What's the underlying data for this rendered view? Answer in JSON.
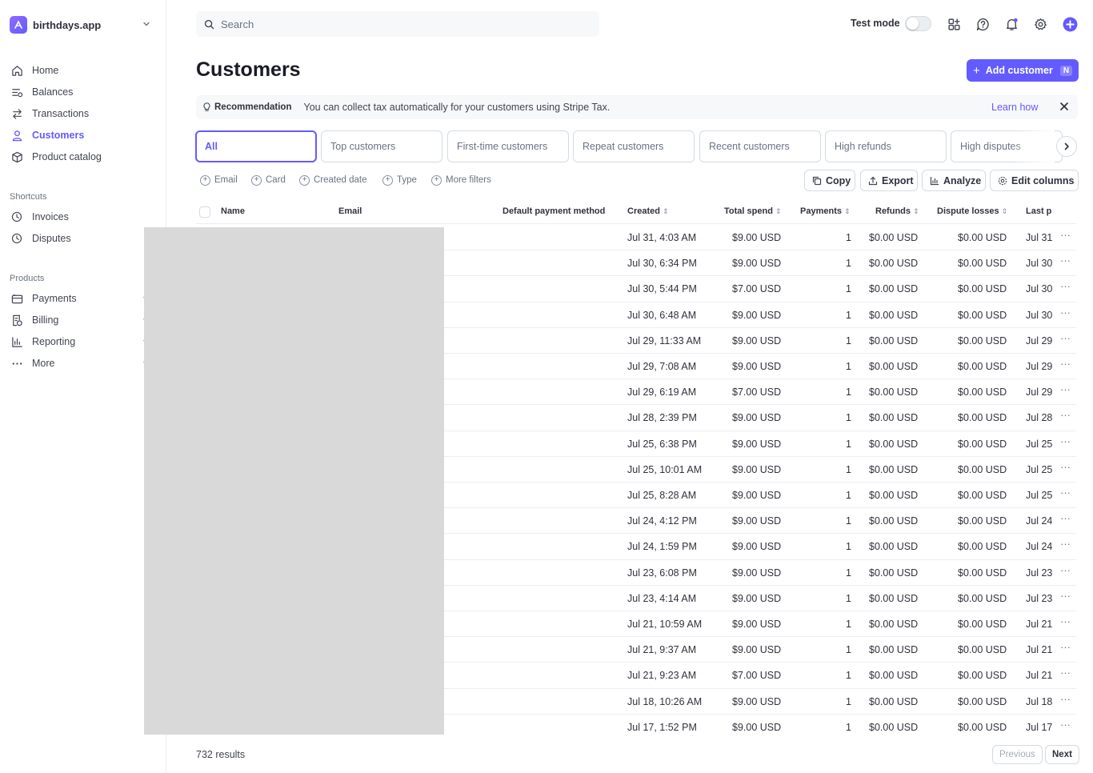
{
  "brand": {
    "name": "birthdays.app"
  },
  "sidebar": {
    "items": [
      {
        "label": "Home",
        "icon": "home-icon"
      },
      {
        "label": "Balances",
        "icon": "balances-icon"
      },
      {
        "label": "Transactions",
        "icon": "transactions-icon"
      },
      {
        "label": "Customers",
        "icon": "customers-icon",
        "active": true
      },
      {
        "label": "Product catalog",
        "icon": "product-catalog-icon"
      }
    ],
    "shortcuts_label": "Shortcuts",
    "shortcuts": [
      {
        "label": "Invoices",
        "icon": "clock-icon"
      },
      {
        "label": "Disputes",
        "icon": "clock-icon"
      }
    ],
    "products_label": "Products",
    "products": [
      {
        "label": "Payments",
        "icon": "payments-icon"
      },
      {
        "label": "Billing",
        "icon": "billing-icon"
      },
      {
        "label": "Reporting",
        "icon": "reporting-icon"
      },
      {
        "label": "More",
        "icon": "more-icon"
      }
    ]
  },
  "topbar": {
    "search_placeholder": "Search",
    "test_mode_label": "Test mode",
    "test_mode_on": false
  },
  "header": {
    "title": "Customers",
    "add_button_label": "Add customer",
    "add_button_shortcut": "N"
  },
  "banner": {
    "label": "Recommendation",
    "text": "You can collect tax automatically for your customers using Stripe Tax.",
    "link": "Learn how"
  },
  "tabs": [
    {
      "label": "All",
      "active": true
    },
    {
      "label": "Top customers"
    },
    {
      "label": "First-time customers"
    },
    {
      "label": "Repeat customers"
    },
    {
      "label": "Recent customers"
    },
    {
      "label": "High refunds"
    },
    {
      "label": "High disputes"
    }
  ],
  "filters": [
    "Email",
    "Card",
    "Created date",
    "Type",
    "More filters"
  ],
  "actions": [
    "Copy",
    "Export",
    "Analyze",
    "Edit columns"
  ],
  "table": {
    "columns": [
      "Name",
      "Email",
      "Default payment method",
      "Created",
      "Total spend",
      "Payments",
      "Refunds",
      "Dispute losses",
      "Last p"
    ],
    "rows": [
      {
        "created": "Jul 31, 4:03 AM",
        "total": "$9.00 USD",
        "payments": "1",
        "refunds": "$0.00 USD",
        "disputes": "$0.00 USD",
        "last": "Jul 31"
      },
      {
        "created": "Jul 30, 6:34 PM",
        "total": "$9.00 USD",
        "payments": "1",
        "refunds": "$0.00 USD",
        "disputes": "$0.00 USD",
        "last": "Jul 30"
      },
      {
        "created": "Jul 30, 5:44 PM",
        "total": "$7.00 USD",
        "payments": "1",
        "refunds": "$0.00 USD",
        "disputes": "$0.00 USD",
        "last": "Jul 30"
      },
      {
        "created": "Jul 30, 6:48 AM",
        "total": "$9.00 USD",
        "payments": "1",
        "refunds": "$0.00 USD",
        "disputes": "$0.00 USD",
        "last": "Jul 30"
      },
      {
        "created": "Jul 29, 11:33 AM",
        "total": "$9.00 USD",
        "payments": "1",
        "refunds": "$0.00 USD",
        "disputes": "$0.00 USD",
        "last": "Jul 29"
      },
      {
        "created": "Jul 29, 7:08 AM",
        "total": "$9.00 USD",
        "payments": "1",
        "refunds": "$0.00 USD",
        "disputes": "$0.00 USD",
        "last": "Jul 29"
      },
      {
        "created": "Jul 29, 6:19 AM",
        "total": "$7.00 USD",
        "payments": "1",
        "refunds": "$0.00 USD",
        "disputes": "$0.00 USD",
        "last": "Jul 29"
      },
      {
        "created": "Jul 28, 2:39 PM",
        "total": "$9.00 USD",
        "payments": "1",
        "refunds": "$0.00 USD",
        "disputes": "$0.00 USD",
        "last": "Jul 28"
      },
      {
        "created": "Jul 25, 6:38 PM",
        "total": "$9.00 USD",
        "payments": "1",
        "refunds": "$0.00 USD",
        "disputes": "$0.00 USD",
        "last": "Jul 25"
      },
      {
        "created": "Jul 25, 10:01 AM",
        "total": "$9.00 USD",
        "payments": "1",
        "refunds": "$0.00 USD",
        "disputes": "$0.00 USD",
        "last": "Jul 25"
      },
      {
        "created": "Jul 25, 8:28 AM",
        "total": "$9.00 USD",
        "payments": "1",
        "refunds": "$0.00 USD",
        "disputes": "$0.00 USD",
        "last": "Jul 25"
      },
      {
        "created": "Jul 24, 4:12 PM",
        "total": "$9.00 USD",
        "payments": "1",
        "refunds": "$0.00 USD",
        "disputes": "$0.00 USD",
        "last": "Jul 24"
      },
      {
        "created": "Jul 24, 1:59 PM",
        "total": "$9.00 USD",
        "payments": "1",
        "refunds": "$0.00 USD",
        "disputes": "$0.00 USD",
        "last": "Jul 24"
      },
      {
        "created": "Jul 23, 6:08 PM",
        "total": "$9.00 USD",
        "payments": "1",
        "refunds": "$0.00 USD",
        "disputes": "$0.00 USD",
        "last": "Jul 23"
      },
      {
        "created": "Jul 23, 4:14 AM",
        "total": "$9.00 USD",
        "payments": "1",
        "refunds": "$0.00 USD",
        "disputes": "$0.00 USD",
        "last": "Jul 23"
      },
      {
        "created": "Jul 21, 10:59 AM",
        "total": "$9.00 USD",
        "payments": "1",
        "refunds": "$0.00 USD",
        "disputes": "$0.00 USD",
        "last": "Jul 21"
      },
      {
        "created": "Jul 21, 9:37 AM",
        "total": "$9.00 USD",
        "payments": "1",
        "refunds": "$0.00 USD",
        "disputes": "$0.00 USD",
        "last": "Jul 21"
      },
      {
        "created": "Jul 21, 9:23 AM",
        "total": "$7.00 USD",
        "payments": "1",
        "refunds": "$0.00 USD",
        "disputes": "$0.00 USD",
        "last": "Jul 21"
      },
      {
        "created": "Jul 18, 10:26 AM",
        "total": "$9.00 USD",
        "payments": "1",
        "refunds": "$0.00 USD",
        "disputes": "$0.00 USD",
        "last": "Jul 18"
      },
      {
        "created": "Jul 17, 1:52 PM",
        "total": "$9.00 USD",
        "payments": "1",
        "refunds": "$0.00 USD",
        "disputes": "$0.00 USD",
        "last": "Jul 17"
      }
    ]
  },
  "footer": {
    "results": "732 results",
    "previous": "Previous",
    "next": "Next"
  },
  "colors": {
    "accent": "#635bff",
    "text": "#30313d",
    "muted": "#6a7383",
    "border": "#d5dbe1"
  }
}
